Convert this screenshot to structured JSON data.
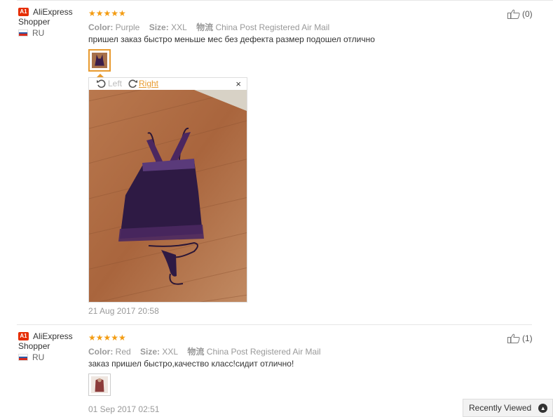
{
  "reviews": [
    {
      "user_badge": "A1",
      "user_name_line1": "AliExpress",
      "user_name_line2": "Shopper",
      "country": "RU",
      "stars": "★★★★★",
      "color_label": "Color:",
      "color_value": "Purple",
      "size_label": "Size:",
      "size_value": "XXL",
      "logistics_label": "物流",
      "logistics_value": "China Post Registered Air Mail",
      "text": "пришел заказ быстро меньше мес без дефекта размер подошел отлично",
      "likes": "(0)",
      "rotate_left": "Left",
      "rotate_right": "Right",
      "close": "×",
      "date": "21 Aug 2017 20:58"
    },
    {
      "user_badge": "A1",
      "user_name_line1": "AliExpress",
      "user_name_line2": "Shopper",
      "country": "RU",
      "stars": "★★★★★",
      "color_label": "Color:",
      "color_value": "Red",
      "size_label": "Size:",
      "size_value": "XXL",
      "logistics_label": "物流",
      "logistics_value": "China Post Registered Air Mail",
      "text": "заказ пришел быстро,качество класс!сидит отлично!",
      "likes": "(1)",
      "date": "01 Sep 2017 02:51"
    }
  ],
  "recently_viewed": "Recently Viewed",
  "colors": {
    "star": "#f39c12",
    "accent": "#e89a2e",
    "badge": "#e62e04"
  }
}
